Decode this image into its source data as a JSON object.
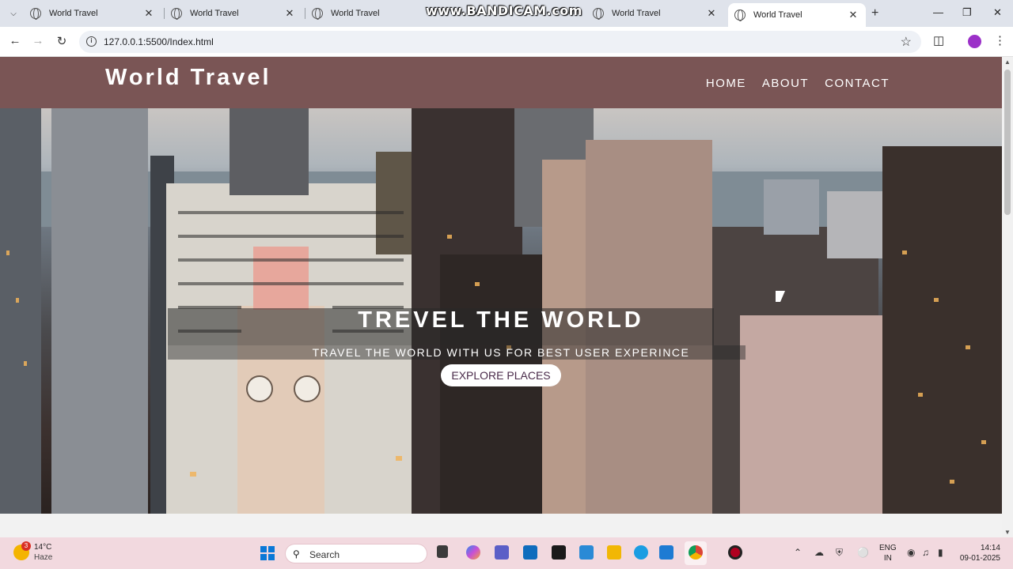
{
  "browser": {
    "tabs": [
      {
        "title": "World Travel",
        "active": false
      },
      {
        "title": "World Travel",
        "active": false
      },
      {
        "title": "World Travel",
        "active": false
      },
      {
        "title": "World Travel",
        "active": false
      },
      {
        "title": "World Travel",
        "active": true
      }
    ],
    "watermark": "www.BANDICAM.com",
    "url": "127.0.0.1:5500/Index.html"
  },
  "site": {
    "logo": "World Travel",
    "nav": [
      "HOME",
      "ABOUT",
      "CONTACT"
    ],
    "hero": {
      "title": "TREVEL THE WORLD",
      "subtitle": "TRAVEL THE WORLD WITH US FOR BEST USER EXPERINCE",
      "button": "EXPLORE PLACES"
    }
  },
  "taskbar": {
    "weather_badge": "3",
    "temperature": "14°C",
    "condition": "Haze",
    "search_label": "Search",
    "language": "ENG",
    "region": "IN",
    "time": "14:14",
    "date": "09-01-2025"
  },
  "colors": {
    "header_bg": "#7a5555",
    "taskbar_bg": "#f2d9df",
    "tabstrip_bg": "#dfe3eb"
  }
}
